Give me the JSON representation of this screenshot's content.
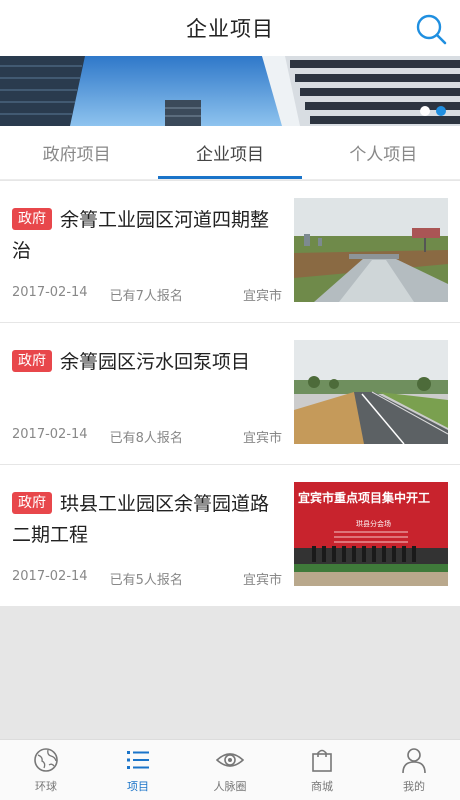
{
  "header": {
    "title": "企业项目",
    "search_icon": "search-icon"
  },
  "banner": {
    "dots": 2,
    "active_dot": 2
  },
  "tabs": [
    {
      "label": "政府项目",
      "active": false
    },
    {
      "label": "企业项目",
      "active": true
    },
    {
      "label": "个人项目",
      "active": false
    }
  ],
  "projects": [
    {
      "badge": "政府",
      "title": "余箐工业园区河道四期整治",
      "date": "2017-02-14",
      "signups": "已有7人报名",
      "city": "宜宾市"
    },
    {
      "badge": "政府",
      "title": "余箐园区污水回泵项目",
      "date": "2017-02-14",
      "signups": "已有8人报名",
      "city": "宜宾市"
    },
    {
      "badge": "政府",
      "title": "珙县工业园区余箐园道路二期工程",
      "date": "2017-02-14",
      "signups": "已有5人报名",
      "city": "宜宾市"
    }
  ],
  "thumb3_text": {
    "headline": "宜宾市重点项目集中开工",
    "sub": "珙县分会场"
  },
  "bottom_nav": [
    {
      "label": "环球",
      "icon": "globe-icon",
      "active": false
    },
    {
      "label": "项目",
      "icon": "list-icon",
      "active": true
    },
    {
      "label": "人脉圈",
      "icon": "eye-icon",
      "active": false
    },
    {
      "label": "商城",
      "icon": "shopping-bag-icon",
      "active": false
    },
    {
      "label": "我的",
      "icon": "user-icon",
      "active": false
    }
  ],
  "colors": {
    "accent": "#1a74c9",
    "badge": "#e8474b",
    "background": "#e6e6e6"
  }
}
